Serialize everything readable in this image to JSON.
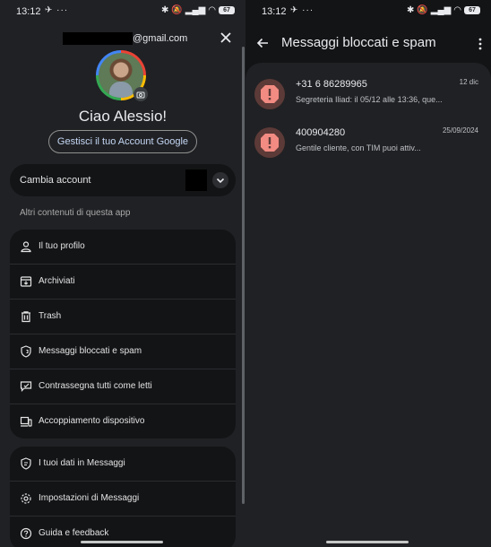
{
  "status_left": {
    "time": "13:12",
    "notif": "✈ ···"
  },
  "status_right": {
    "time": "13:12",
    "notif": "✈ ···",
    "battery": "67"
  },
  "account": {
    "email_suffix": "@gmail.com",
    "greeting": "Ciao Alessio!",
    "manage_label": "Gestisci il tuo Account Google",
    "switch_label": "Cambia account"
  },
  "section_label": "Altri contenuti di questa app",
  "menu": [
    {
      "label": "Il tuo profilo",
      "icon": "person-icon"
    },
    {
      "label": "Archiviati",
      "icon": "archive-icon"
    },
    {
      "label": "Trash",
      "icon": "trash-icon"
    },
    {
      "label": "Messaggi bloccati e spam",
      "icon": "shield-icon"
    },
    {
      "label": "Contrassegna tutti come letti",
      "icon": "mark-read-icon"
    },
    {
      "label": "Accoppiamento dispositivo",
      "icon": "devices-icon"
    }
  ],
  "menu2": [
    {
      "label": "I tuoi dati in Messaggi",
      "icon": "shield-data-icon"
    },
    {
      "label": "Impostazioni di Messaggi",
      "icon": "gear-icon"
    },
    {
      "label": "Guida e feedback",
      "icon": "help-icon"
    }
  ],
  "right_title": "Messaggi bloccati e spam",
  "messages": [
    {
      "sender": "+31 6 86289965",
      "preview": "Segreteria Iliad: il 05/12 alle 13:36, que...",
      "date": "12 dic"
    },
    {
      "sender": "400904280",
      "preview": "Gentile cliente, con TIM puoi attiv...",
      "date": "25/09/2024"
    }
  ],
  "colors": {
    "bg": "#202124",
    "card": "#131416",
    "spam_avatar": "#5c3a37",
    "spam_mark": "#f28b82",
    "link": "#c4d7f5"
  }
}
